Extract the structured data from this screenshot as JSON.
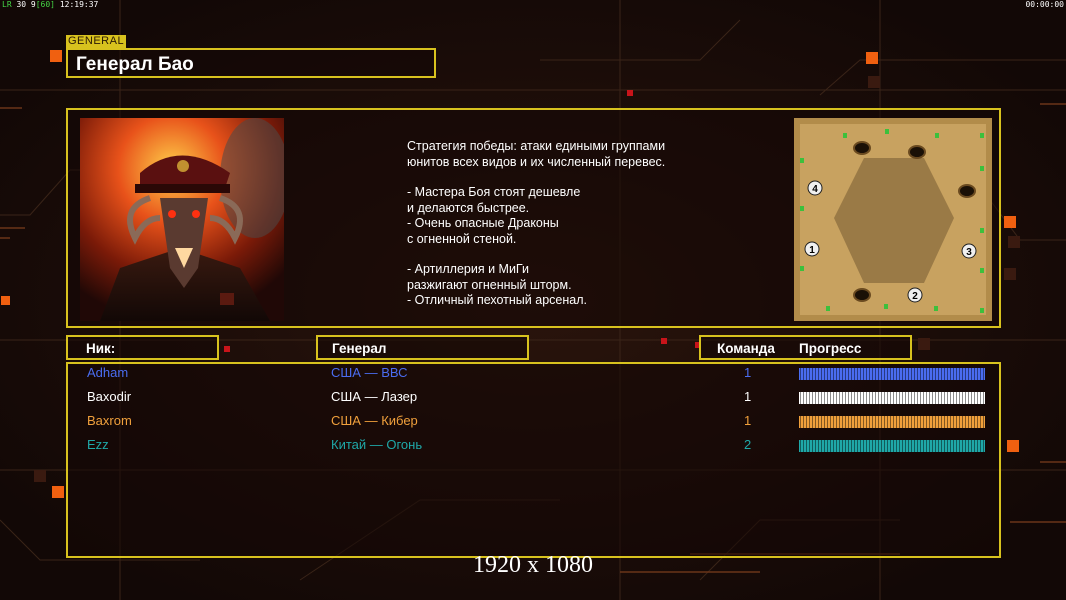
{
  "hud": {
    "left_tag": "LR",
    "left_nums": "30 9",
    "left_bracket": "[60]",
    "left_time": "12:19:37",
    "right_time": "00:00:00"
  },
  "general": {
    "tag": "GENERAL",
    "name": "Генерал Бао",
    "strategy": [
      "Стратегия победы: атаки едиными группами",
      "юнитов всех видов и их численный перевес.",
      "",
      "- Мастера Боя стоят дешевле",
      "и делаются быстрее.",
      "- Очень опасные Драконы",
      "с огненной стеной.",
      "",
      "- Артиллерия и МиГи",
      "разжигают огненный шторм.",
      "- Отличный пехотный арсенал."
    ]
  },
  "map": {
    "spawn_labels": [
      "4",
      "1",
      "3",
      "2"
    ]
  },
  "table": {
    "headers": {
      "nick": "Ник:",
      "general": "Генерал",
      "team": "Команда",
      "progress": "Прогресс"
    },
    "rows": [
      {
        "nick": "Adham",
        "general": "США — ВВС",
        "team": "1",
        "color": "#4a6cf0",
        "progress": 1.0
      },
      {
        "nick": "Baxodir",
        "general": "США — Лазер",
        "team": "1",
        "color": "#ffffff",
        "progress": 1.0
      },
      {
        "nick": "Baxrom",
        "general": "США — Кибер",
        "team": "1",
        "color": "#f0a03c",
        "progress": 1.0
      },
      {
        "nick": "Ezz",
        "general": "Китай — Огонь",
        "team": "2",
        "color": "#1fa8a8",
        "progress": 1.0
      }
    ]
  },
  "resolution": "1920 x 1080",
  "colors": {
    "accent": "#d8c21e",
    "background": "#1a0c08",
    "orange": "#f06010"
  }
}
